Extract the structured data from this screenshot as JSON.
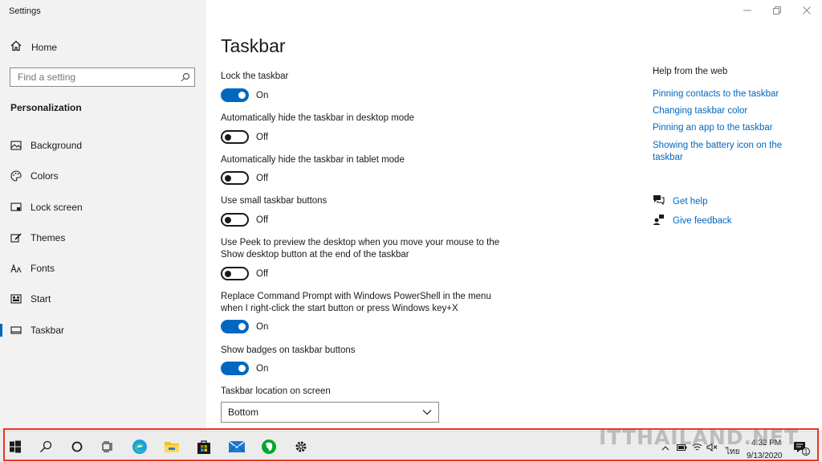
{
  "window": {
    "title": "Settings"
  },
  "sidebar": {
    "home_label": "Home",
    "search_placeholder": "Find a setting",
    "section_title": "Personalization",
    "items": [
      {
        "label": "Background",
        "icon": "image-icon"
      },
      {
        "label": "Colors",
        "icon": "palette-icon"
      },
      {
        "label": "Lock screen",
        "icon": "lock-screen-icon"
      },
      {
        "label": "Themes",
        "icon": "brush-icon"
      },
      {
        "label": "Fonts",
        "icon": "font-icon"
      },
      {
        "label": "Start",
        "icon": "start-icon"
      },
      {
        "label": "Taskbar",
        "icon": "taskbar-icon",
        "selected": true
      }
    ]
  },
  "main": {
    "title": "Taskbar",
    "settings": [
      {
        "label": "Lock the taskbar",
        "state": "On"
      },
      {
        "label": "Automatically hide the taskbar in desktop mode",
        "state": "Off"
      },
      {
        "label": "Automatically hide the taskbar in tablet mode",
        "state": "Off"
      },
      {
        "label": "Use small taskbar buttons",
        "state": "Off"
      },
      {
        "label": "Use Peek to preview the desktop when you move your mouse to the Show desktop button at the end of the taskbar",
        "state": "Off"
      },
      {
        "label": "Replace Command Prompt with Windows PowerShell in the menu when I right-click the start button or press Windows key+X",
        "state": "On"
      },
      {
        "label": "Show badges on taskbar buttons",
        "state": "On"
      }
    ],
    "location_label": "Taskbar location on screen",
    "location_value": "Bottom"
  },
  "help": {
    "title": "Help from the web",
    "links": [
      "Pinning contacts to the taskbar",
      "Changing taskbar color",
      "Pinning an app to the taskbar",
      "Showing the battery icon on the taskbar"
    ],
    "get_help": "Get help",
    "give_feedback": "Give feedback"
  },
  "taskbar": {
    "time": "4:32 PM",
    "date": "9/13/2020",
    "language": "ไทย",
    "notification_count": "1",
    "icons": [
      "windows-start-icon",
      "search-icon",
      "cortana-icon",
      "task-view-icon",
      "edge-icon",
      "file-explorer-icon",
      "store-icon",
      "mail-icon",
      "evernote-icon",
      "settings-gear-icon"
    ]
  },
  "watermark": "ITTHAILAND.NET",
  "colors": {
    "accent": "#0067c0",
    "highlight_frame": "#e8361f",
    "sidebar_bg": "#f2f2f2"
  }
}
